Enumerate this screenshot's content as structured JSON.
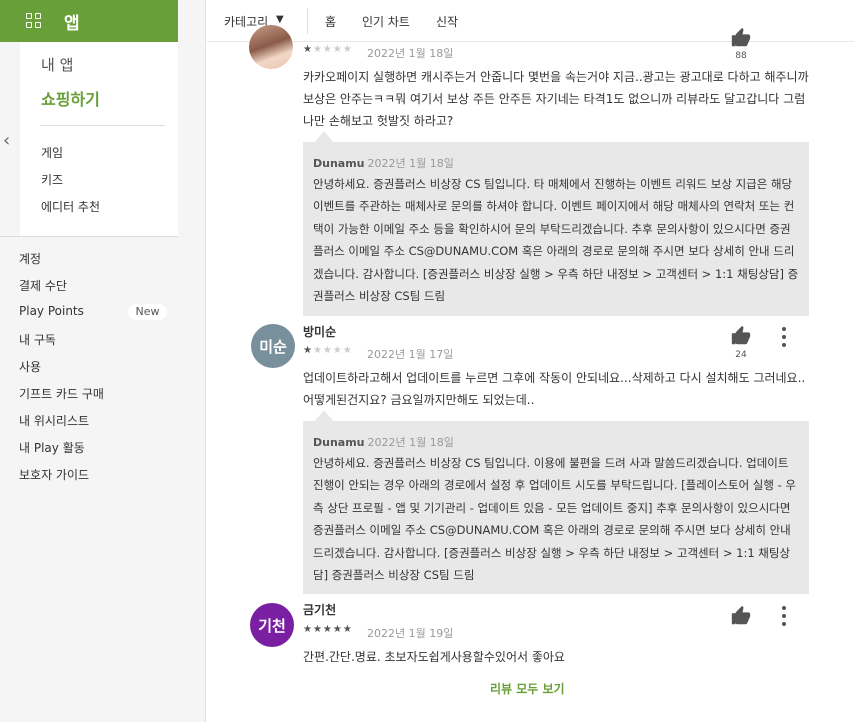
{
  "sidebar": {
    "apps_label": "앱",
    "my_apps": "내 앱",
    "shopping": "쇼핑하기",
    "categories": [
      "게임",
      "키즈",
      "에디터 추천"
    ],
    "account": [
      "계정",
      "결제 수단",
      "Play Points",
      "내 구독",
      "사용",
      "기프트 카드 구매",
      "내 위시리스트",
      "내 Play 활동",
      "보호자 가이드"
    ],
    "new_badge": "New",
    "accent": "#689f38"
  },
  "topnav": {
    "category": "카테고리",
    "links": [
      "홈",
      "인기 차트",
      "신작"
    ]
  },
  "reviews": [
    {
      "avatar_text": "",
      "name": "",
      "rating": 1,
      "stars": "★★★★★",
      "date": "2022년 1월 18일",
      "likes": "88",
      "text": "카카오페이지 실행하면 캐시주는거 안줍니다 몇번을 속는거야 지금..광고는 광고대로 다하고 해주니까 보상은 안주는ㅋㅋ뭐 여기서 보상 주든 안주든 자기네는 타격1도 없으니까 리뷰라도 달고갑니다 그럼 나만 손해보고 헛발짓 하라고?",
      "reply": {
        "developer": "Dunamu",
        "date": "2022년 1월 18일",
        "text": "안녕하세요. 증권플러스 비상장 CS 팀입니다. 타 매체에서 진행하는 이벤트 리워드 보상 지급은 해당 이벤트를 주관하는 매체사로 문의를 하셔야 합니다. 이벤트 페이지에서 해당 매체사의 연락처 또는 컨택이 가능한 이메일 주소 등을 확인하시어 문의 부탁드리겠습니다. 추후 문의사항이 있으시다면 증권플러스 이메일 주소 CS@DUNAMU.COM 혹은 아래의 경로로 문의해 주시면 보다 상세히 안내 드리겠습니다. 감사합니다. [증권플러스 비상장 실행 > 우측 하단 내정보 > 고객센터 > 1:1 채팅상담] 증권플러스 비상장 CS팀 드림"
      }
    },
    {
      "avatar_text": "미순",
      "avatar_color": "#78909c",
      "name": "방미순",
      "rating": 1,
      "stars": "★★★★★",
      "date": "2022년 1월 17일",
      "likes": "24",
      "text": "업데이트하라고해서 업데이트를 누르면 그후에 작동이 안되네요...삭제하고 다시 설치해도 그러네요.. 어떻게된건지요? 금요일까지만해도 되었는데..",
      "reply": {
        "developer": "Dunamu",
        "date": "2022년 1월 18일",
        "text": "안녕하세요. 증권플러스 비상장 CS 팀입니다. 이용에 불편을 드려 사과 말씀드리겠습니다. 업데이트 진행이 안되는 경우 아래의 경로에서 설정 후 업데이트 시도를 부탁드립니다. [플레이스토어 실행 - 우측 상단 프로필 - 앱 및 기기관리 - 업데이트 있음 - 모든 업데이트 중지] 추후 문의사항이 있으시다면 증권플러스 이메일 주소 CS@DUNAMU.COM 혹은 아래의 경로로 문의해 주시면 보다 상세히 안내 드리겠습니다. 감사합니다. [증권플러스 비상장 실행 > 우측 하단 내정보 > 고객센터 > 1:1 채팅상담] 증권플러스 비상장 CS팀 드림"
      }
    },
    {
      "avatar_text": "기천",
      "avatar_color": "#7b1fa2",
      "name": "금기천",
      "rating": 5,
      "stars": "★★★★★",
      "date": "2022년 1월 19일",
      "likes": "",
      "text": "간편.간단.명료. 초보자도쉽게사용할수있어서 좋아요"
    }
  ],
  "see_all": "리뷰 모두 보기"
}
